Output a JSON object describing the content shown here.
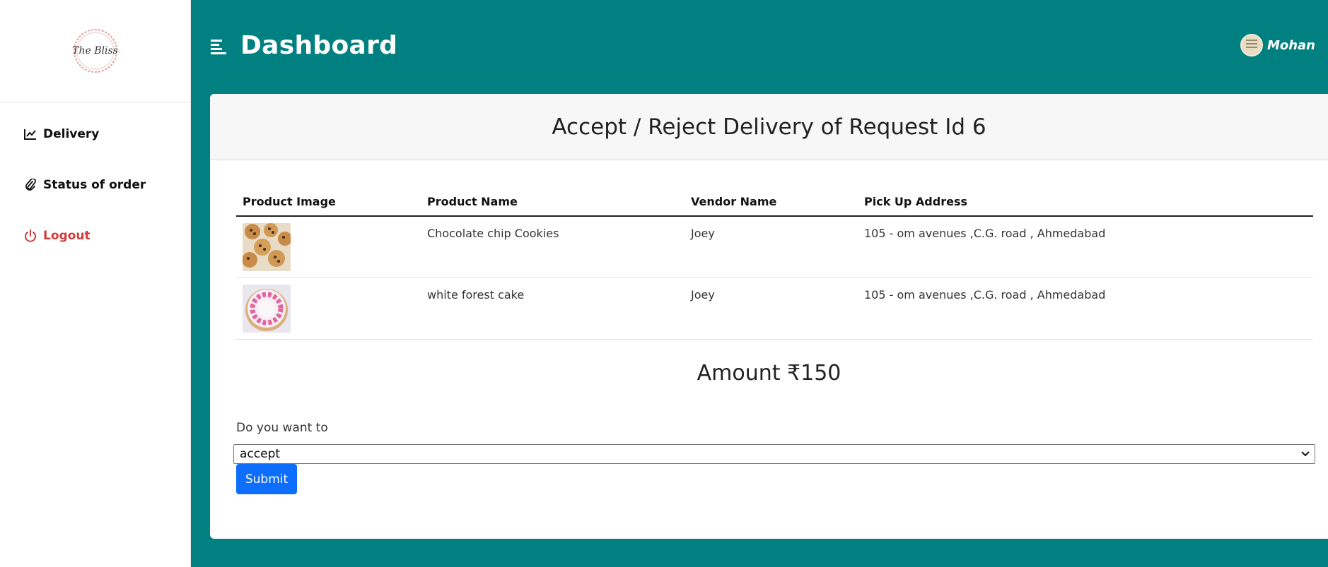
{
  "brand": {
    "logo_text": "The Bliss"
  },
  "sidebar": {
    "items": [
      {
        "label": "Delivery",
        "icon": "chart-line-icon"
      },
      {
        "label": "Status of order",
        "icon": "paperclip-icon"
      },
      {
        "label": "Logout",
        "icon": "power-icon"
      }
    ]
  },
  "header": {
    "title": "Dashboard",
    "user_name": "Mohan"
  },
  "card": {
    "title": "Accept / Reject Delivery of Request Id 6",
    "table": {
      "headers": [
        "Product Image",
        "Product Name",
        "Vendor Name",
        "Pick Up Address"
      ],
      "rows": [
        {
          "image": "cookies-image",
          "product_name": "Chocolate chip Cookies",
          "vendor": "Joey",
          "address": "105 - om avenues ,C.G. road , Ahmedabad"
        },
        {
          "image": "cake-image",
          "product_name": "white forest cake",
          "vendor": "Joey",
          "address": "105 - om avenues ,C.G. road , Ahmedabad"
        }
      ]
    },
    "amount": "Amount ₹150",
    "question": "Do you want to",
    "select_value": "accept",
    "submit_label": "Submit"
  },
  "colors": {
    "background": "#008080",
    "primary_button": "#0d6efd",
    "logout": "#d13a3a"
  }
}
